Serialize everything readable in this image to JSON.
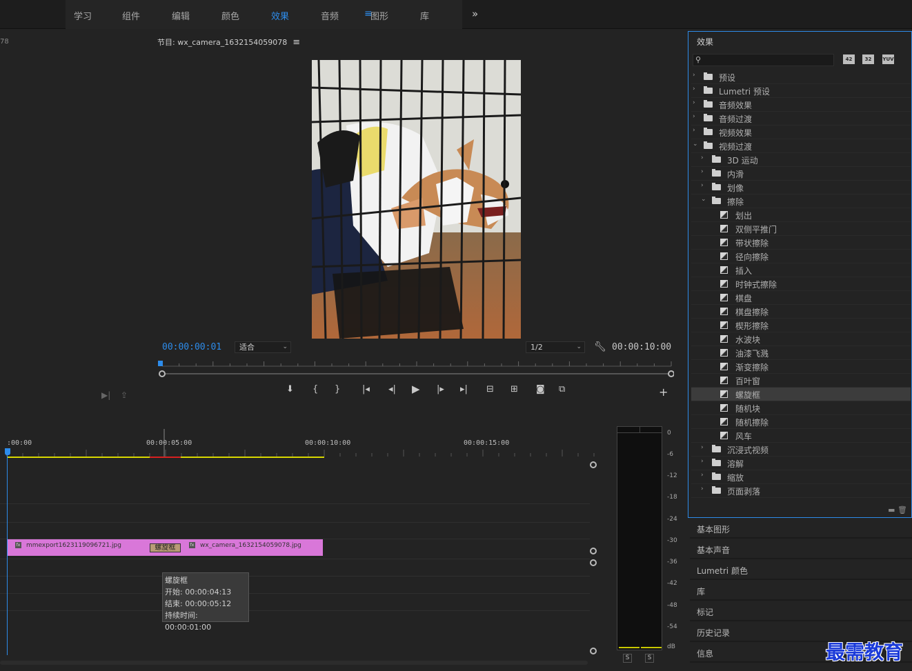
{
  "workspace_tabs": [
    "学习",
    "组件",
    "编辑",
    "颜色",
    "效果",
    "音频",
    "图形",
    "库"
  ],
  "active_tab": "效果",
  "source_panel": {
    "cut_text": "78"
  },
  "program": {
    "title": "节目: wx_camera_1632154059078",
    "timecode_current": "00:00:00:01",
    "fit_value": "适合",
    "resolution_value": "1/2",
    "timecode_duration": "00:00:10:00"
  },
  "effects": {
    "title": "效果",
    "tool_labels": [
      "42",
      "32",
      "YUV"
    ],
    "tree": [
      {
        "label": "预设",
        "level": 0,
        "type": "bin",
        "open": false
      },
      {
        "label": "Lumetri 预设",
        "level": 0,
        "type": "bin",
        "open": false
      },
      {
        "label": "音频效果",
        "level": 0,
        "type": "folder",
        "open": false
      },
      {
        "label": "音频过渡",
        "level": 0,
        "type": "folder",
        "open": false
      },
      {
        "label": "视频效果",
        "level": 0,
        "type": "folder",
        "open": false
      },
      {
        "label": "视频过渡",
        "level": 0,
        "type": "folder",
        "open": true
      },
      {
        "label": "3D 运动",
        "level": 1,
        "type": "folder",
        "open": false
      },
      {
        "label": "内滑",
        "level": 1,
        "type": "folder",
        "open": false
      },
      {
        "label": "划像",
        "level": 1,
        "type": "folder",
        "open": false
      },
      {
        "label": "擦除",
        "level": 1,
        "type": "folder",
        "open": true
      },
      {
        "label": "划出",
        "level": 2,
        "type": "effect"
      },
      {
        "label": "双侧平推门",
        "level": 2,
        "type": "effect"
      },
      {
        "label": "带状擦除",
        "level": 2,
        "type": "effect"
      },
      {
        "label": "径向擦除",
        "level": 2,
        "type": "effect"
      },
      {
        "label": "插入",
        "level": 2,
        "type": "effect"
      },
      {
        "label": "时钟式擦除",
        "level": 2,
        "type": "effect"
      },
      {
        "label": "棋盘",
        "level": 2,
        "type": "effect"
      },
      {
        "label": "棋盘擦除",
        "level": 2,
        "type": "effect"
      },
      {
        "label": "楔形擦除",
        "level": 2,
        "type": "effect"
      },
      {
        "label": "水波块",
        "level": 2,
        "type": "effect"
      },
      {
        "label": "油漆飞溅",
        "level": 2,
        "type": "effect"
      },
      {
        "label": "渐变擦除",
        "level": 2,
        "type": "effect"
      },
      {
        "label": "百叶窗",
        "level": 2,
        "type": "effect"
      },
      {
        "label": "螺旋框",
        "level": 2,
        "type": "effect",
        "selected": true
      },
      {
        "label": "随机块",
        "level": 2,
        "type": "effect"
      },
      {
        "label": "随机擦除",
        "level": 2,
        "type": "effect"
      },
      {
        "label": "风车",
        "level": 2,
        "type": "effect"
      },
      {
        "label": "沉浸式视频",
        "level": 1,
        "type": "folder",
        "open": false
      },
      {
        "label": "溶解",
        "level": 1,
        "type": "folder",
        "open": false
      },
      {
        "label": "缩放",
        "level": 1,
        "type": "folder",
        "open": false
      },
      {
        "label": "页面剥落",
        "level": 1,
        "type": "folder",
        "open": false
      }
    ]
  },
  "side_panels": [
    "基本图形",
    "基本声音",
    "Lumetri 颜色",
    "库",
    "标记",
    "历史记录",
    "信息"
  ],
  "timeline": {
    "ruler_labels": [
      ":00:00",
      "00:00:05:00",
      "00:00:10:00",
      "00:00:15:00"
    ],
    "clip1_name": "mmexport1623119096721.jpg",
    "clip2_name": "wx_camera_1632154059078.jpg",
    "transition_label": "螺旋框",
    "tooltip": {
      "title": "螺旋框",
      "start": "开始: 00:00:04:13",
      "end": "结束: 00:00:05:12",
      "duration": "持续时间: 00:00:01:00"
    }
  },
  "meter": {
    "db_labels": [
      "0",
      "-6",
      "-12",
      "-18",
      "-24",
      "-30",
      "-36",
      "-42",
      "-48",
      "-54",
      "dB"
    ],
    "solo_labels": [
      "S",
      "S"
    ]
  },
  "watermark": "最需教育",
  "colors": {
    "accent": "#2d8ceb",
    "clip": "#d977d9",
    "panel": "#232323"
  }
}
